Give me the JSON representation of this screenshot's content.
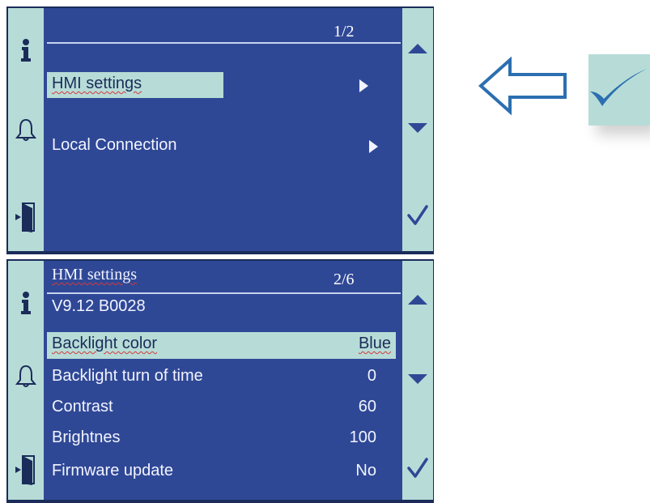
{
  "screen1": {
    "page": "1/2",
    "menu": [
      {
        "label": "HMI settings",
        "selected": true,
        "arrow": "chevron-right-icon"
      },
      {
        "label": "Local Connection",
        "selected": false,
        "arrow": "chevron-right-icon"
      }
    ]
  },
  "screen2": {
    "title": "HMI settings",
    "page": "2/6",
    "version": "V9.12  B0028",
    "rows": [
      {
        "label": "Backlight color",
        "value": "Blue",
        "selected": true
      },
      {
        "label": "Backlight turn of time",
        "value": "0",
        "selected": false
      },
      {
        "label": "Contrast",
        "value": "60",
        "selected": false
      },
      {
        "label": "Brightnes",
        "value": "100",
        "selected": false
      },
      {
        "label": "Firmware update",
        "value": "No",
        "selected": false
      }
    ]
  },
  "icons": {
    "left_bar": [
      "info-icon",
      "bell-icon",
      "exit-door-icon"
    ],
    "right_bar": [
      "scroll-up-icon",
      "scroll-down-icon",
      "check-icon"
    ],
    "callout": [
      "left-arrow-icon",
      "check-icon"
    ]
  },
  "colors": {
    "frame": "#1b2c5a",
    "screen": "#2f4896",
    "bar": "#b7dcd7",
    "check": "#2b6fb0"
  }
}
